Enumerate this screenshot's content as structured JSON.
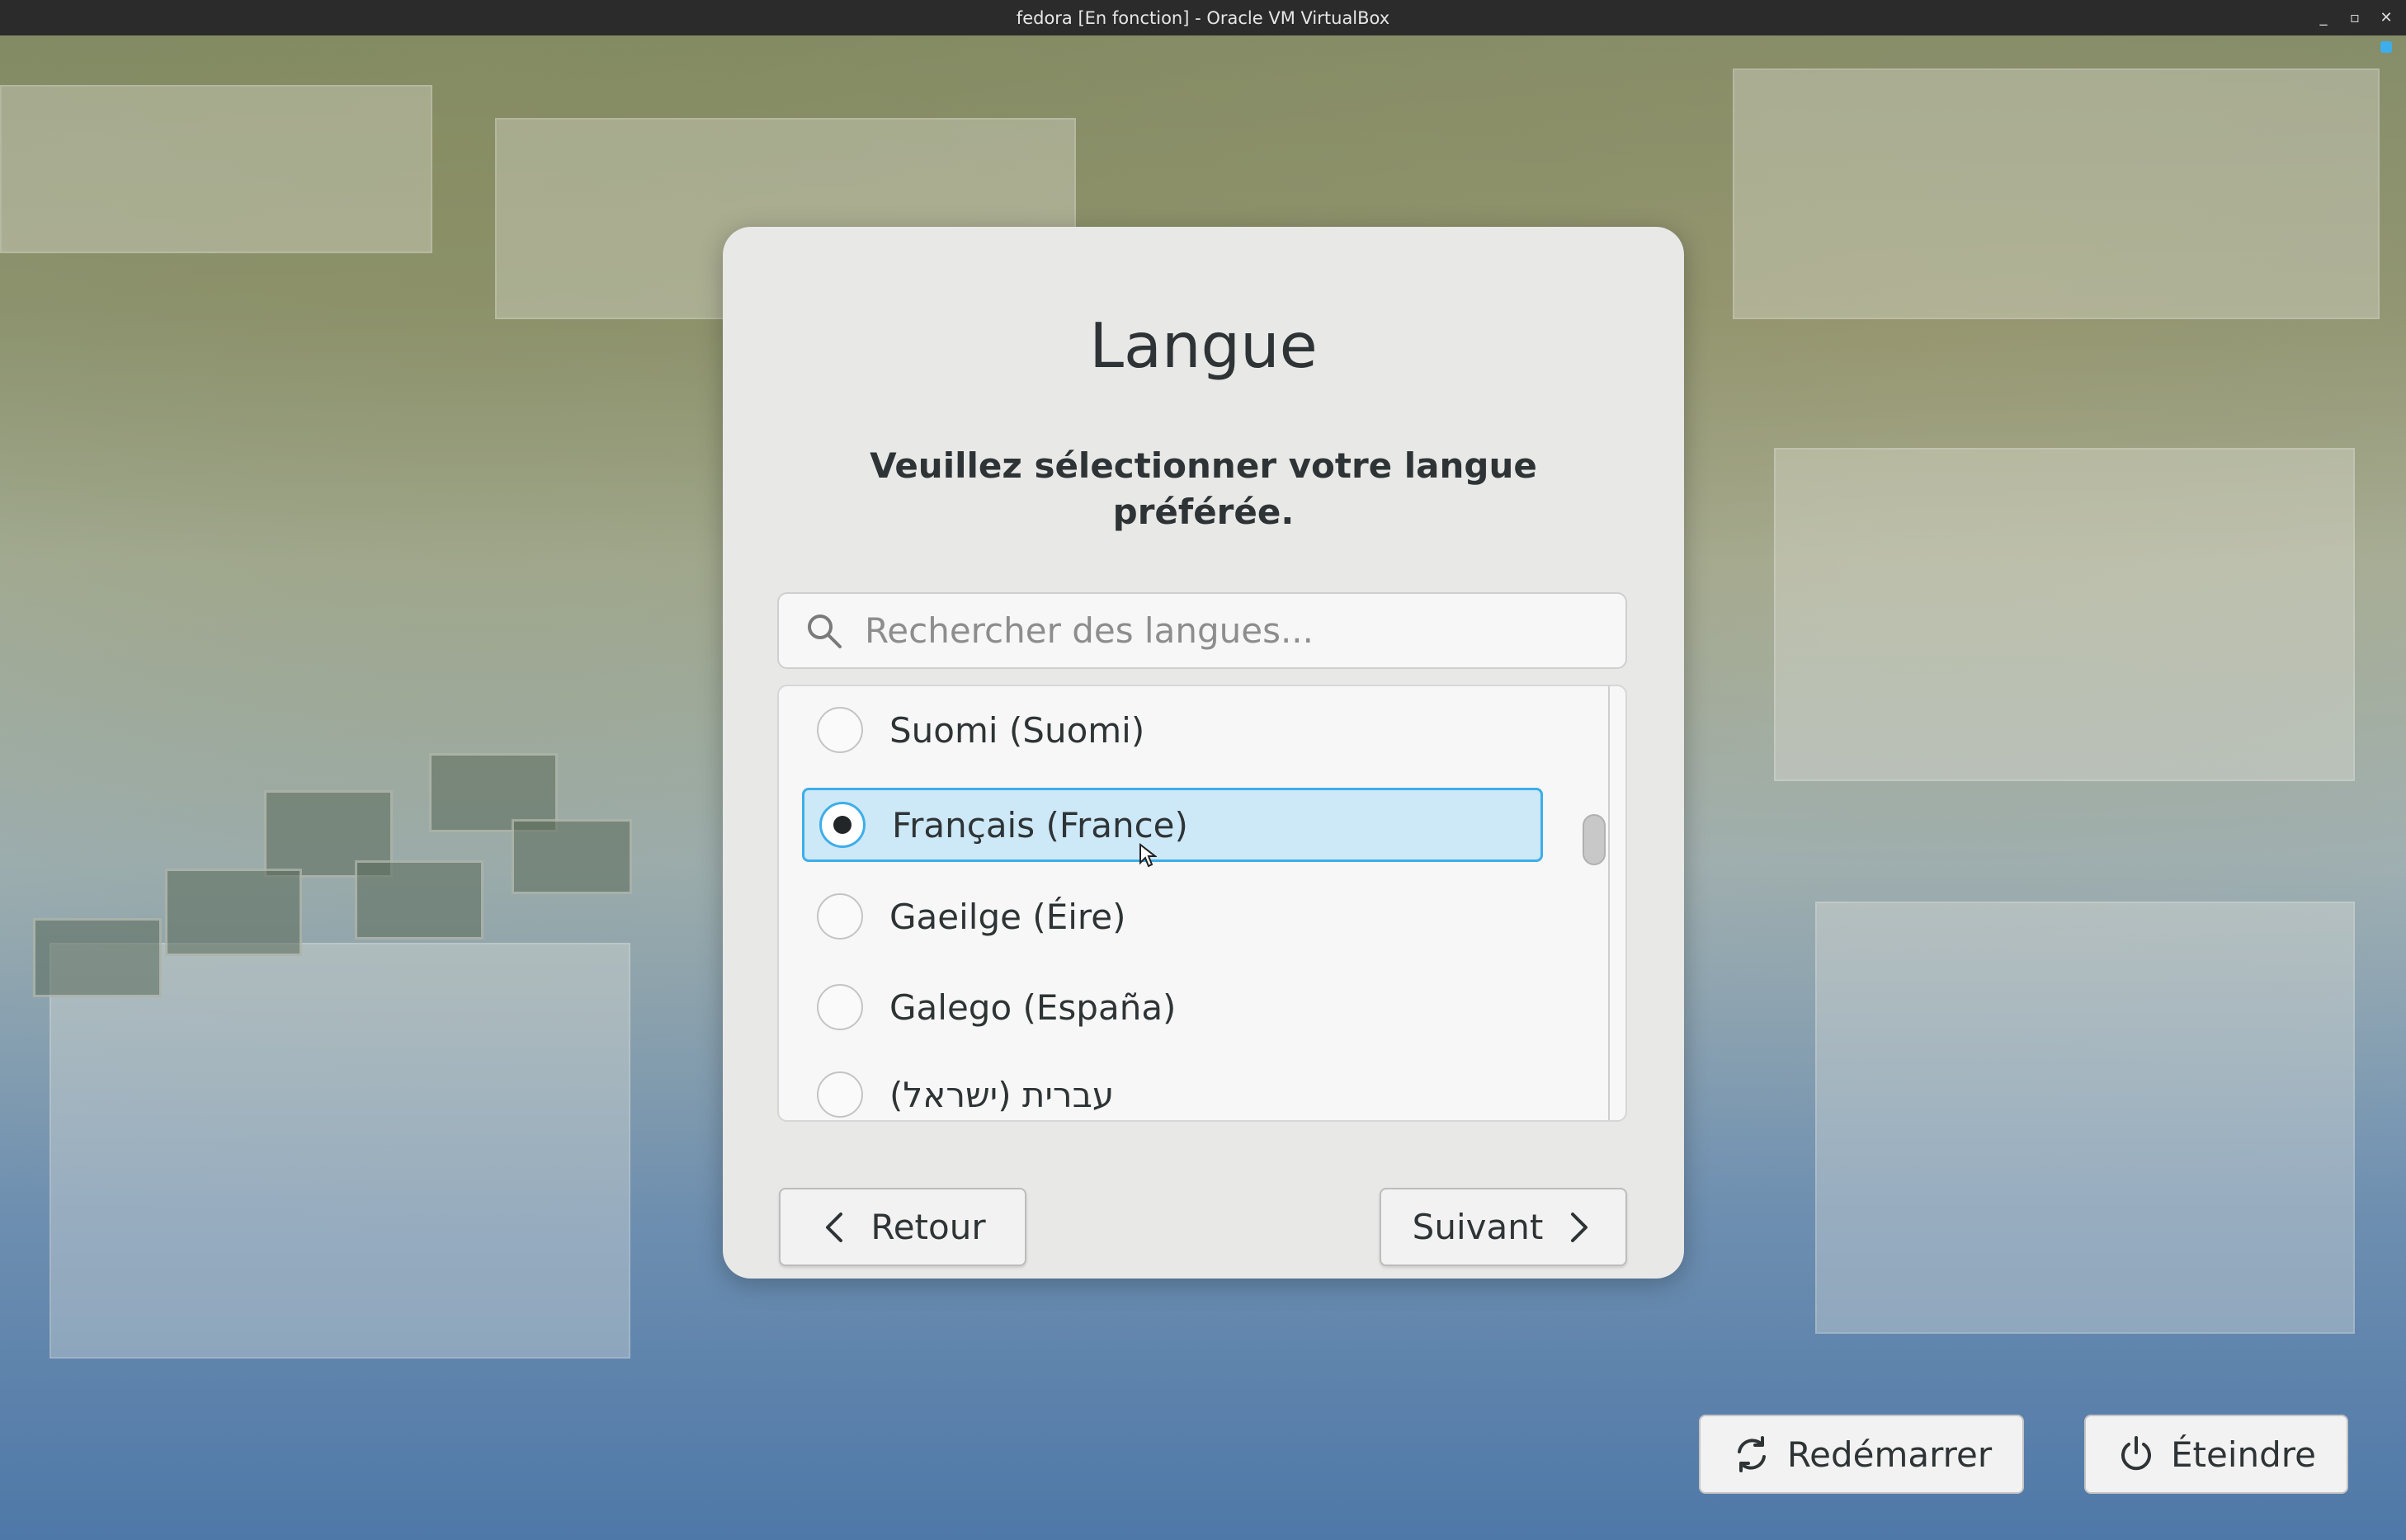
{
  "window": {
    "title": "fedora [En fonction] - Oracle VM VirtualBox",
    "controls": [
      "minimize-icon",
      "maximize-icon",
      "close-icon"
    ]
  },
  "dialog": {
    "title": "Langue",
    "subtitle": "Veuillez sélectionner votre langue préférée.",
    "search": {
      "placeholder": "Rechercher des langues...",
      "value": ""
    },
    "languages": [
      {
        "label": "Suomi (Suomi)",
        "selected": false
      },
      {
        "label": "Français (France)",
        "selected": true
      },
      {
        "label": "Gaeilge (Éire)",
        "selected": false
      },
      {
        "label": "Galego (España)",
        "selected": false
      },
      {
        "label": "עברית (ישראל)",
        "selected": false
      }
    ],
    "back_label": "Retour",
    "next_label": "Suivant"
  },
  "footer": {
    "restart_label": "Redémarrer",
    "power_label": "Éteindre"
  },
  "colors": {
    "accent": "#3daee9",
    "selection_bg": "#cde8f7",
    "dialog_bg": "#e8e8e7",
    "titlebar_bg": "#2b2b2b"
  }
}
